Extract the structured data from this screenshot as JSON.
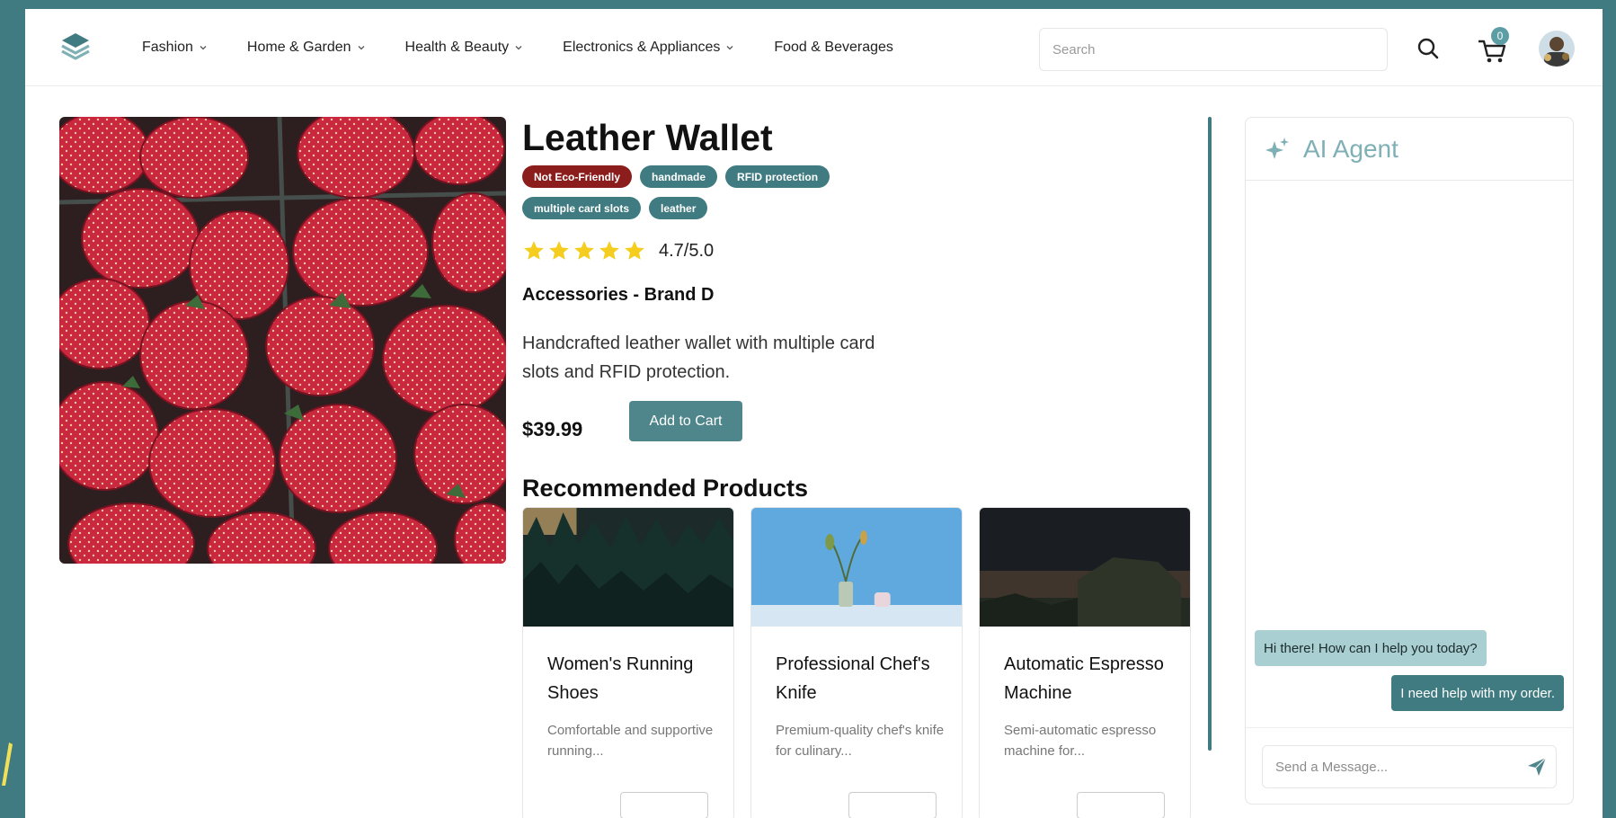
{
  "nav": {
    "items": [
      {
        "label": "Fashion",
        "has_dropdown": true
      },
      {
        "label": "Home & Garden",
        "has_dropdown": true
      },
      {
        "label": "Health & Beauty",
        "has_dropdown": true
      },
      {
        "label": "Electronics & Appliances",
        "has_dropdown": true
      },
      {
        "label": "Food & Beverages",
        "has_dropdown": false
      }
    ],
    "search_placeholder": "Search",
    "cart_count": "0"
  },
  "product": {
    "title": "Leather Wallet",
    "tags": [
      {
        "label": "Not Eco-Friendly",
        "color": "#8b1d1d"
      },
      {
        "label": "handmade",
        "color": "#3f7b80"
      },
      {
        "label": "RFID protection",
        "color": "#3f7b80"
      },
      {
        "label": "multiple card slots",
        "color": "#3f7b80"
      },
      {
        "label": "leather",
        "color": "#3f7b80"
      }
    ],
    "rating_stars": 5,
    "rating_text": "4.7/5.0",
    "category": "Accessories - Brand D",
    "description": "Handcrafted leather wallet with multiple card slots and RFID protection.",
    "price": "$39.99",
    "add_to_cart_label": "Add to Cart",
    "image_icon": "strawberries-photo"
  },
  "recommended": {
    "title": "Recommended Products",
    "items": [
      {
        "name": "Women's Running Shoes",
        "description": "Comfortable and supportive running...",
        "image_icon": "forest-photo"
      },
      {
        "name": "Professional Chef's Knife",
        "description": "Premium-quality chef's knife for culinary...",
        "image_icon": "plant-vase-photo"
      },
      {
        "name": "Automatic Espresso Machine",
        "description": "Semi-automatic espresso machine for...",
        "image_icon": "barn-night-photo"
      }
    ]
  },
  "agent": {
    "title": "AI Agent",
    "messages": [
      {
        "role": "assistant",
        "text": "Hi there! How can I help you today?"
      },
      {
        "role": "user",
        "text": "I need help with my order."
      }
    ],
    "input_placeholder": "Send a Message..."
  },
  "colors": {
    "accent": "#3f7b80",
    "accent_light": "#a9cfd2",
    "warning_tag": "#8b1d1d",
    "star": "#f5cd1f"
  }
}
